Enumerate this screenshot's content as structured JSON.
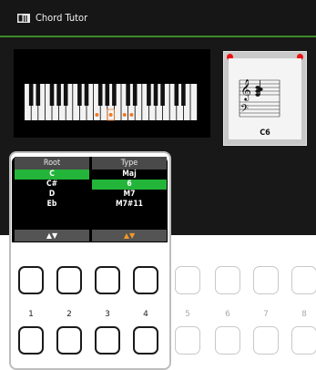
{
  "title": "Chord Tutor",
  "chord_name": "C6",
  "root": {
    "header": "Root",
    "options": [
      "C",
      "C#",
      "D",
      "Eb"
    ],
    "selected": 0,
    "footer_arrows": [
      "▲",
      "▼"
    ]
  },
  "type": {
    "header": "Type",
    "options": [
      "Maj",
      "6",
      "M7",
      "M7#11"
    ],
    "selected": 1,
    "footer_arrows": [
      "▲",
      "▼"
    ]
  },
  "buttons": [
    {
      "label": "1"
    },
    {
      "label": "2"
    },
    {
      "label": "3"
    },
    {
      "label": "4"
    },
    {
      "label": "5"
    },
    {
      "label": "6"
    },
    {
      "label": "7"
    },
    {
      "label": "8"
    }
  ],
  "colors": {
    "accent_green": "#23b43a",
    "marker_orange": "#f07a25",
    "pin_red": "#e11111"
  },
  "icons": [
    "chord-tutor-app-icon",
    "treble-clef-icon",
    "bass-clef-icon",
    "arrow-up-icon",
    "arrow-down-icon"
  ]
}
